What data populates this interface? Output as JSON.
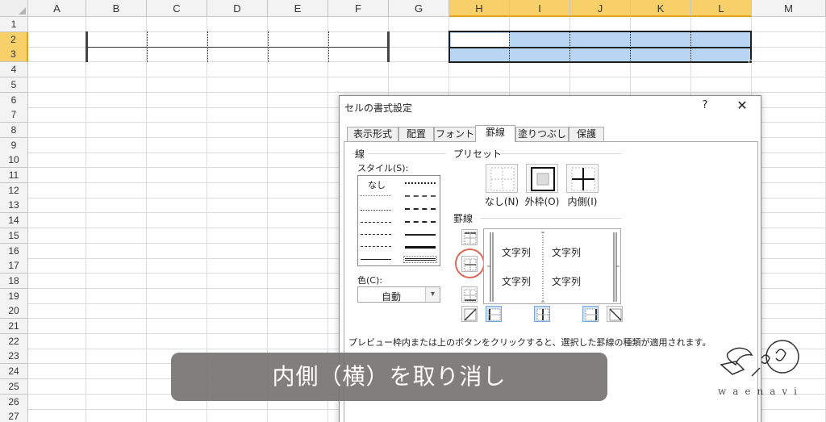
{
  "sheet": {
    "columns": [
      "A",
      "B",
      "C",
      "D",
      "E",
      "F",
      "G",
      "H",
      "I",
      "J",
      "K",
      "L",
      "M"
    ],
    "selected_columns": [
      "H",
      "I",
      "J",
      "K",
      "L"
    ],
    "rows": [
      "1",
      "2",
      "3",
      "4",
      "5",
      "6",
      "7",
      "8",
      "9",
      "10",
      "11",
      "12",
      "13",
      "14",
      "15",
      "16",
      "17",
      "18",
      "19",
      "20",
      "21",
      "22",
      "23",
      "24",
      "25",
      "26",
      "27"
    ],
    "selected_rows": [
      "2",
      "3"
    ],
    "selection_color": "#b8d5f4"
  },
  "dialog": {
    "title": "セルの書式設定",
    "help_label": "?",
    "close_label": "✕",
    "tabs": [
      {
        "label": "表示形式",
        "active": false
      },
      {
        "label": "配置",
        "active": false
      },
      {
        "label": "フォント",
        "active": false
      },
      {
        "label": "罫線",
        "active": true
      },
      {
        "label": "塗りつぶし",
        "active": false
      },
      {
        "label": "保護",
        "active": false
      }
    ],
    "line_group": {
      "title": "線",
      "style_label": "スタイル(S):",
      "none_label": "なし",
      "color_label": "色(C):",
      "color_value": "自動"
    },
    "preset_group": {
      "title": "プリセット",
      "buttons": [
        {
          "label": "なし(N)",
          "icon": "preset-none-icon"
        },
        {
          "label": "外枠(O)",
          "icon": "preset-outline-icon"
        },
        {
          "label": "内側(I)",
          "icon": "preset-inside-icon"
        }
      ]
    },
    "border_group": {
      "title": "罫線",
      "preview_texts": [
        "文字列",
        "文字列",
        "文字列",
        "文字列"
      ]
    },
    "hint": "プレビュー枠内または上のボタンをクリックすると、選択した罫線の種類が適用されます。"
  },
  "caption": "内側（横）を取り消し",
  "logo": {
    "word": "waenavi"
  }
}
